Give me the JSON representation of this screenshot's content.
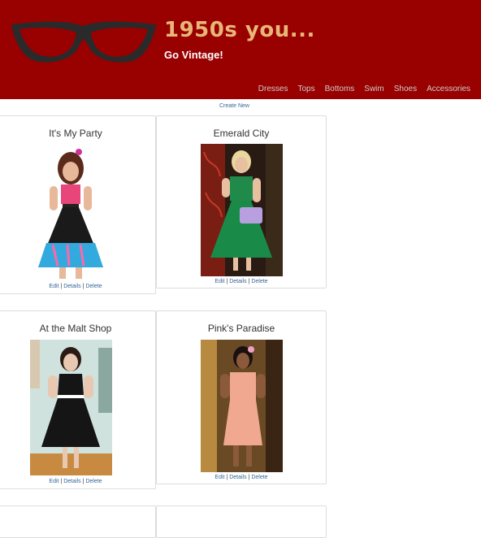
{
  "header": {
    "title": "1950s you...",
    "tagline": "Go Vintage!",
    "nav": [
      "Dresses",
      "Tops",
      "Bottoms",
      "Swim",
      "Shoes",
      "Accessories"
    ]
  },
  "create_new": "Create New",
  "actions": {
    "edit": "Edit",
    "sep": "|",
    "details": "Details",
    "delete": "Delete"
  },
  "products": [
    {
      "title": "It's My Party"
    },
    {
      "title": "Emerald City"
    },
    {
      "title": "At the Malt Shop"
    },
    {
      "title": "Pink's Paradise"
    }
  ],
  "colors": {
    "header_bg": "#990000",
    "title": "#e8b777",
    "link": "#336699"
  }
}
